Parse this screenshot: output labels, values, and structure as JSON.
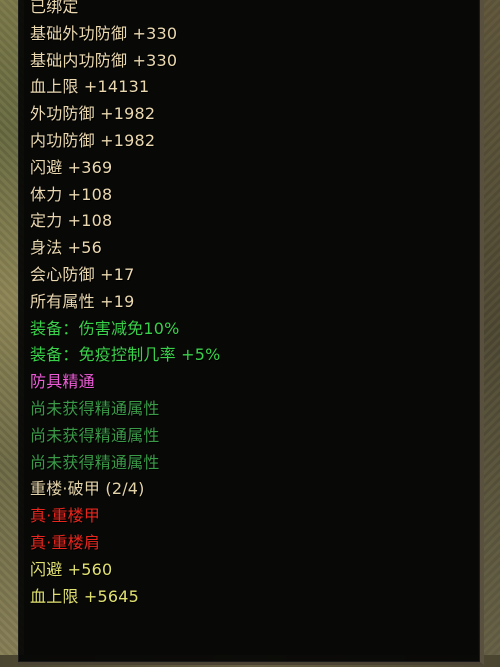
{
  "tooltip": {
    "lines": [
      {
        "text": "已绑定",
        "color": "#ead8b0"
      },
      {
        "text": "基础外功防御 +330",
        "color": "#ead8b0"
      },
      {
        "text": "基础内功防御 +330",
        "color": "#ead8b0"
      },
      {
        "text": "血上限 +14131",
        "color": "#ead8b0"
      },
      {
        "text": "外功防御 +1982",
        "color": "#ead8b0"
      },
      {
        "text": "内功防御 +1982",
        "color": "#ead8b0"
      },
      {
        "text": "闪避 +369",
        "color": "#ead8b0"
      },
      {
        "text": "体力 +108",
        "color": "#ead8b0"
      },
      {
        "text": "定力 +108",
        "color": "#ead8b0"
      },
      {
        "text": "身法 +56",
        "color": "#ead8b0"
      },
      {
        "text": "会心防御 +17",
        "color": "#ead8b0"
      },
      {
        "text": "所有属性 +19",
        "color": "#ead8b0"
      },
      {
        "text": "装备：伤害减免10%",
        "color": "#3ad14a"
      },
      {
        "text": "装备：免疫控制几率 +5%",
        "color": "#3ad14a"
      },
      {
        "text": "防具精通",
        "color": "#ee5cd8"
      },
      {
        "text": "尚未获得精通属性",
        "color": "#3a9a48"
      },
      {
        "text": "尚未获得精通属性",
        "color": "#3a9a48"
      },
      {
        "text": "尚未获得精通属性",
        "color": "#3a9a48"
      },
      {
        "text": "重楼·破甲 (2/4)",
        "color": "#e2d2a8"
      },
      {
        "text": "真·重楼甲",
        "color": "#e8261e"
      },
      {
        "text": "真·重楼肩",
        "color": "#e8261e"
      },
      {
        "text": "闪避 +560",
        "color": "#e0e070"
      },
      {
        "text": "血上限 +5645",
        "color": "#e0e070"
      }
    ]
  }
}
